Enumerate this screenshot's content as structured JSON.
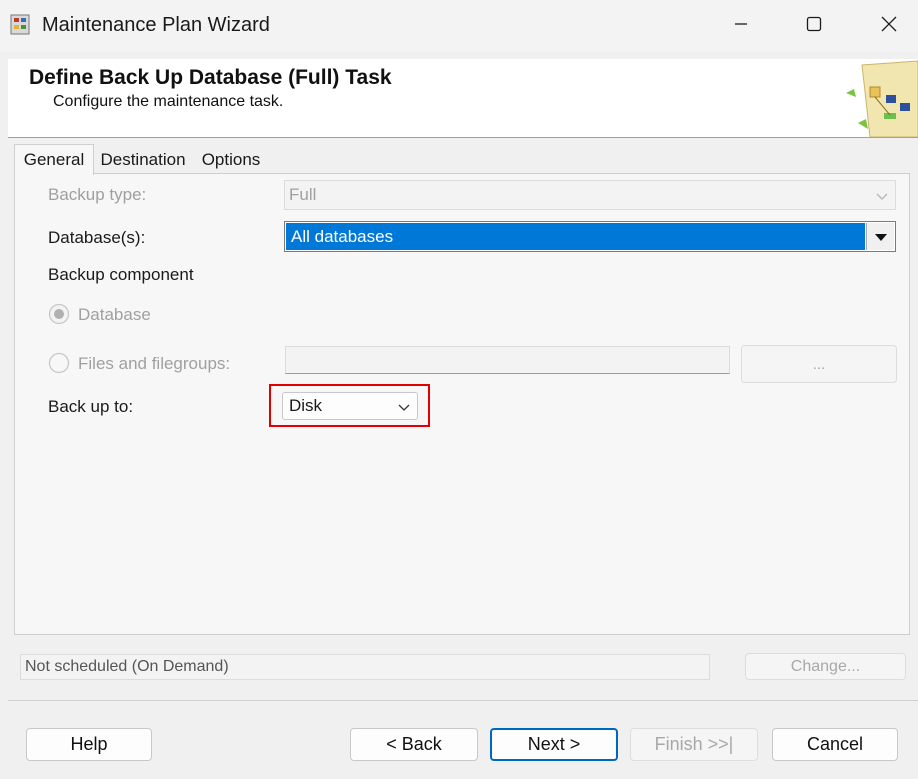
{
  "window": {
    "title": "Maintenance Plan Wizard",
    "icon": "maintenance-plan-icon",
    "minimize_icon": "minimize-icon",
    "maximize_icon": "maximize-icon",
    "close_icon": "close-icon"
  },
  "header": {
    "title": "Define Back Up Database (Full) Task",
    "subtitle": "Configure the maintenance task.",
    "illustration": "wizard-flowchart-icon"
  },
  "tabs": [
    "General",
    "Destination",
    "Options"
  ],
  "form": {
    "backup_type_label": "Backup type:",
    "backup_type_value": "Full",
    "databases_label": "Database(s):",
    "databases_value": "All databases",
    "backup_component_label": "Backup component",
    "radio_database": "Database",
    "radio_files": "Files and filegroups:",
    "files_button": "...",
    "backup_to_label": "Back up to:",
    "backup_to_value": "Disk"
  },
  "schedule": {
    "text": "Not scheduled (On Demand)",
    "change_label": "Change..."
  },
  "buttons": {
    "help": "Help",
    "back": "< Back",
    "next": "Next >",
    "finish": "Finish >>|",
    "cancel": "Cancel"
  },
  "colors": {
    "selection": "#0078d7",
    "highlight_box": "#e00000",
    "next_border": "#0067c0"
  }
}
